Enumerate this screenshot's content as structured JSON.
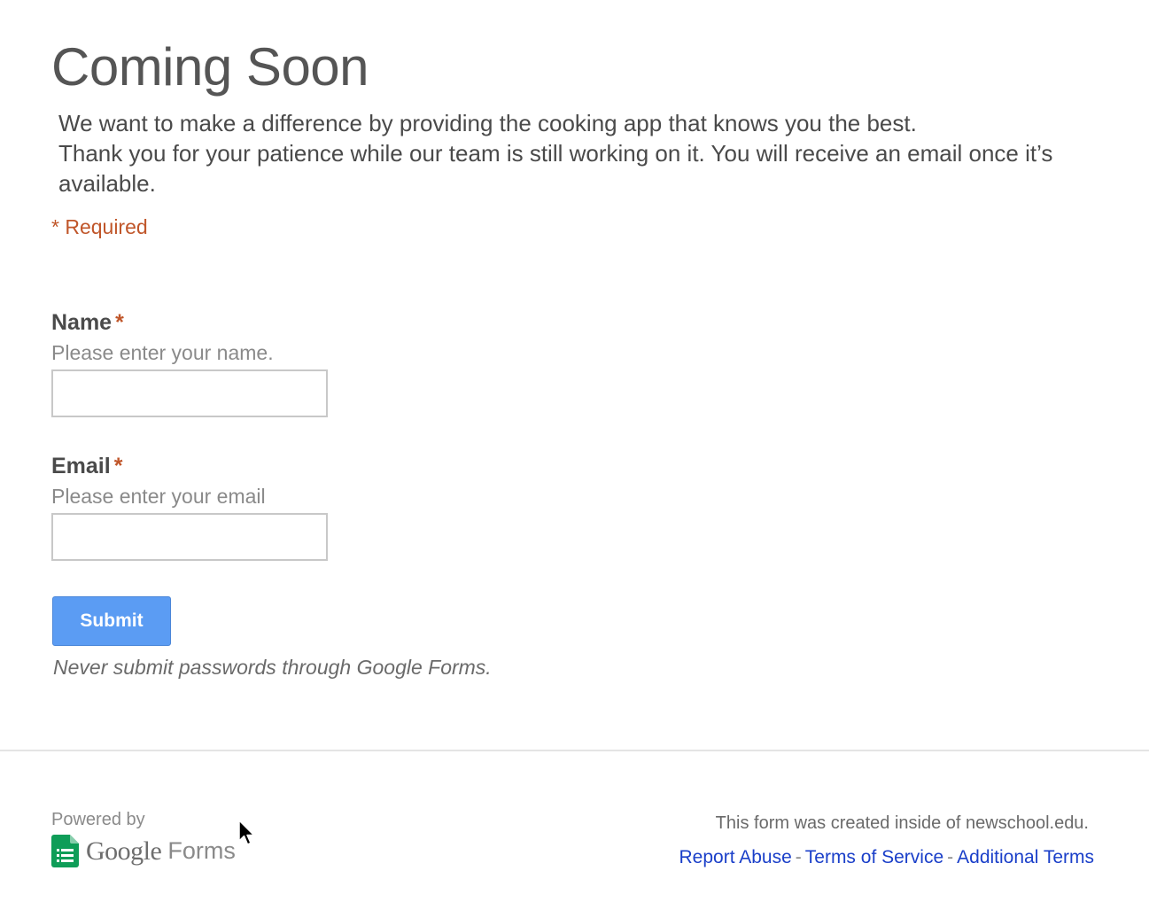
{
  "header": {
    "title": "Coming Soon",
    "description_line1": "We want to make a difference by providing the cooking app that knows you the best.",
    "description_line2": "Thank you for your patience while our team is still working on it. You will receive an email once it’s available."
  },
  "form": {
    "required_note": "* Required",
    "required_star": "*",
    "fields": [
      {
        "label": "Name",
        "help": "Please enter your name.",
        "value": ""
      },
      {
        "label": "Email",
        "help": "Please enter your email",
        "value": ""
      }
    ],
    "submit_label": "Submit",
    "warning": "Never submit passwords through Google Forms."
  },
  "footer": {
    "powered_by": "Powered by",
    "logo_google": "Google",
    "logo_forms": "Forms",
    "created_note": "This form was created inside of newschool.edu.",
    "links": [
      "Report Abuse",
      "Terms of Service",
      "Additional Terms"
    ],
    "separator": "-"
  },
  "colors": {
    "accent": "#5b9cf3",
    "required": "#c0562a",
    "link": "#1a3fc9",
    "forms_green": "#0f9d58"
  },
  "icons": {
    "logo": "google-forms-icon",
    "cursor": "mouse-pointer-icon"
  }
}
